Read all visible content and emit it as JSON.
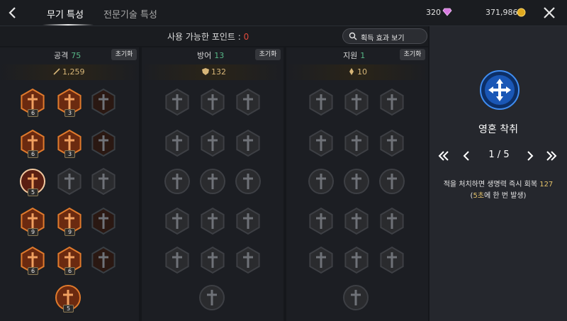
{
  "header": {
    "tabs": [
      {
        "label": "무기 특성",
        "active": true
      },
      {
        "label": "전문기술 특성",
        "active": false
      }
    ],
    "gems": "320",
    "gold": "371,986",
    "gem_icon": "diamond-icon",
    "gold_icon": "coin-icon"
  },
  "points": {
    "label": "사용 가능한 포인트 : ",
    "value": "0",
    "effects_button": "획득 효과 보기"
  },
  "columns": [
    {
      "name": "공격",
      "points": "75",
      "reset": "초기화",
      "stat": "1,259",
      "stat_icon": "sword-icon",
      "accent": "#57b887"
    },
    {
      "name": "방어",
      "points": "13",
      "reset": "초기화",
      "stat": "132",
      "stat_icon": "shield-icon"
    },
    {
      "name": "지원",
      "points": "1",
      "reset": "초기화",
      "stat": "10",
      "stat_icon": "support-icon"
    }
  ],
  "attack_nodes": [
    {
      "label": "6",
      "state": "active"
    },
    {
      "label": "3",
      "state": "active"
    },
    {
      "label": "",
      "state": "partial"
    },
    {
      "label": "6",
      "state": "active"
    },
    {
      "label": "3",
      "state": "active"
    },
    {
      "label": "",
      "state": "partial"
    },
    {
      "label": "5",
      "state": "selected"
    },
    {
      "label": "",
      "state": "locked"
    },
    {
      "label": "",
      "state": "locked"
    },
    {
      "label": "9",
      "state": "active"
    },
    {
      "label": "9",
      "state": "active"
    },
    {
      "label": "",
      "state": "partial"
    },
    {
      "label": "6",
      "state": "active"
    },
    {
      "label": "6",
      "state": "active"
    },
    {
      "label": "",
      "state": "partial"
    },
    {
      "label": "5",
      "state": "active"
    }
  ],
  "skill": {
    "icon": "cross-arrows-icon",
    "title": "영혼 착취",
    "page": "1 / 5",
    "desc_pre": "적을 처치하면 생명력 즉시 회복 ",
    "desc_val": "127",
    "desc_open": "(",
    "desc_time": "5초",
    "desc_post": "에 한 번 발생)"
  },
  "colors": {
    "accent_orange": "#e07a2c",
    "points_green": "#57b887",
    "points_red": "#e04a3c",
    "gold_text": "#e5c36a"
  }
}
